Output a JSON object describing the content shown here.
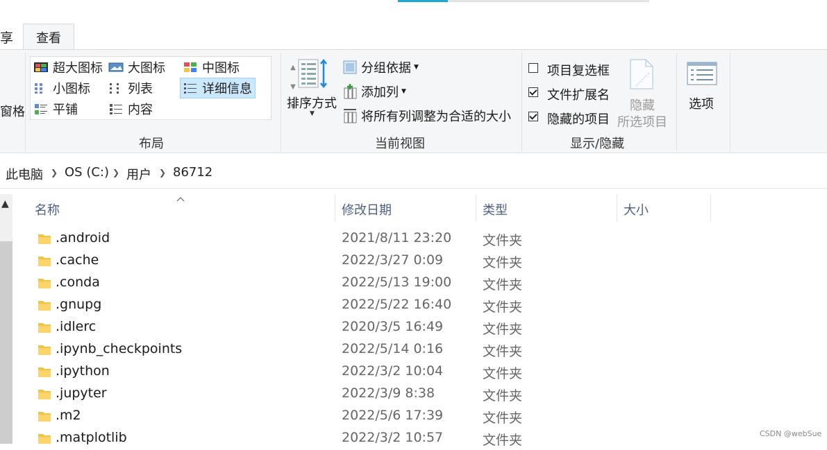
{
  "tabs": {
    "share_partial": "享",
    "view": "查看"
  },
  "ribbon": {
    "partial_left": "窗格",
    "layout": {
      "items": [
        "超大图标",
        "大图标",
        "中图标",
        "小图标",
        "列表",
        "详细信息",
        "平铺",
        "内容"
      ],
      "selected": "详细信息",
      "group_label": "布局"
    },
    "current_view": {
      "sort_label": "排序方式",
      "group_by": "分组依据",
      "add_column": "添加列",
      "fit_columns": "将所有列调整为合适的大小",
      "group_label": "当前视图"
    },
    "show_hide": {
      "item_checkboxes": "项目复选框",
      "file_extensions": "文件扩展名",
      "hidden_items": "隐藏的项目",
      "item_checkboxes_checked": false,
      "file_extensions_checked": true,
      "hidden_items_checked": true,
      "hide_selected_line1": "隐藏",
      "hide_selected_line2": "所选项目",
      "group_label": "显示/隐藏"
    },
    "options": {
      "label": "选项"
    }
  },
  "address": {
    "crumbs": [
      "此电脑",
      "OS (C:)",
      "用户",
      "86712"
    ]
  },
  "columns": {
    "name": "名称",
    "modified": "修改日期",
    "type": "类型",
    "size": "大小"
  },
  "files": [
    {
      "name": ".android",
      "modified": "2021/8/11 23:20",
      "type": "文件夹"
    },
    {
      "name": ".cache",
      "modified": "2022/3/27 0:09",
      "type": "文件夹"
    },
    {
      "name": ".conda",
      "modified": "2022/5/13 19:00",
      "type": "文件夹"
    },
    {
      "name": ".gnupg",
      "modified": "2022/5/22 16:40",
      "type": "文件夹"
    },
    {
      "name": ".idlerc",
      "modified": "2020/3/5 16:49",
      "type": "文件夹"
    },
    {
      "name": ".ipynb_checkpoints",
      "modified": "2022/5/14 0:16",
      "type": "文件夹"
    },
    {
      "name": ".ipython",
      "modified": "2022/3/2 10:04",
      "type": "文件夹"
    },
    {
      "name": ".jupyter",
      "modified": "2022/3/9 8:38",
      "type": "文件夹"
    },
    {
      "name": ".m2",
      "modified": "2022/5/6 17:39",
      "type": "文件夹"
    },
    {
      "name": ".matplotlib",
      "modified": "2022/3/2 10:57",
      "type": "文件夹"
    }
  ],
  "watermark": "CSDN @webSue",
  "colors": {
    "accent": "#1ea7d6",
    "selection": "#cce8ff",
    "folder": "#f5c342"
  }
}
